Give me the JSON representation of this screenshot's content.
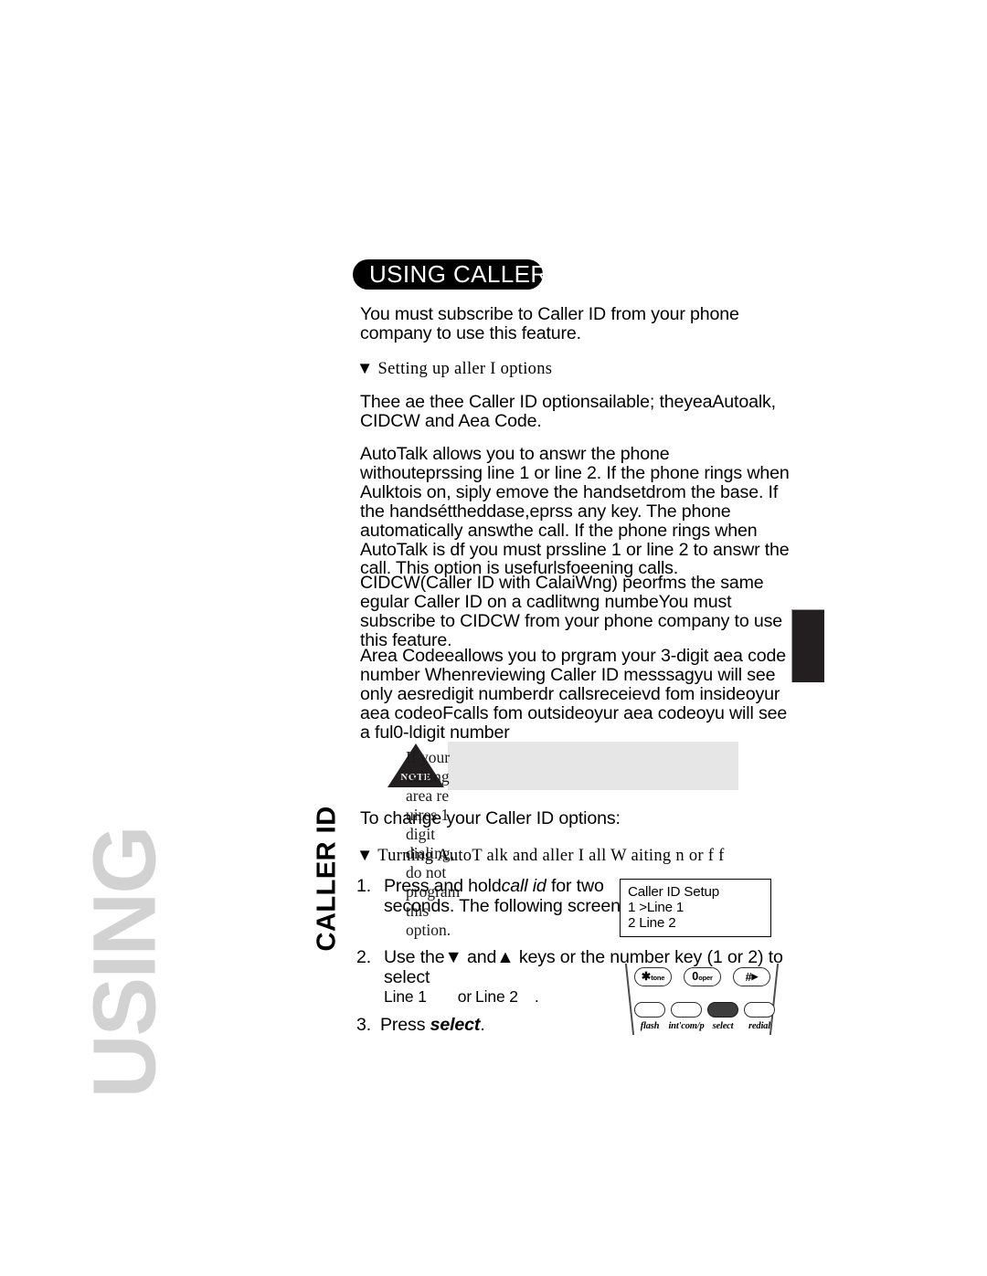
{
  "page": {
    "side_tab_ghost": "USING",
    "side_tab_label": "CALLER ID"
  },
  "header": {
    "banner_title": "USING CALLER ID"
  },
  "intro": {
    "text": "You must subscribe to Caller ID from your phone company to use this feature."
  },
  "subheads": {
    "setting_up": "▼ Setting up  aller I  options",
    "turning_on_off": "▼ Turning AutoT alk and   aller I    all W  aiting  n or   f f"
  },
  "paragraphs": {
    "options_intro": "Thee ae thee Caller ID optionsailable; theyeaAutoalk, CIDCW and Aea Code.",
    "autotalk": "AutoTalk allows you to answr the phone withouteprssing line 1 or line 2. If the phone rings when Aulktois on, siply emove the handsetdrom the base. If the handséttheddase,eprss any key. The phone automatically answthe call. If the phone rings when AutoTalk is df you must prssline 1 or line 2 to answr the call. This option is usefurlsfoeening calls.",
    "cidcw": "CIDCW(Caller ID with CalaiWng) peorfms the same egular Caller ID on a cadlitwng numbeYou must subscribe to CIDCW from your phone company to use this feature.",
    "area_code": "Area Codeeallows you to prgram your 3-digit aea code number Whenreviewing Caller ID messsagyu will see only aesredigit numberdr callsreceievd fom insideoyur aea codeoFcalls fom outsideoyur aea codeoyu will see a ful0-ldigit number"
  },
  "note": {
    "badge": "NOTE",
    "text": "If your calling area re uires 1      digit dialing,\ndo not program this option."
  },
  "to_change": {
    "text": "To change your Caller ID options:"
  },
  "steps": [
    {
      "number": "1.",
      "line1_a": "Press and hold",
      "line1_italic": "call id",
      "line1_b": " for two",
      "line2": "seconds. The following screen appears"
    },
    {
      "number": "2.",
      "line1_a": "Use  the",
      "line1_b": " and",
      "line1_c": " keys or the number key (1 or 2) to select",
      "line2_a": "Line 1",
      "line2_b": "or",
      "line2_c": "Line 2",
      "line2_d": "."
    },
    {
      "number": "3.",
      "text_a": "Press ",
      "text_italic": "select",
      "text_b": "."
    }
  ],
  "lcd": {
    "line1": "Caller ID Setup",
    "line2": "1 >Line 1",
    "line3": "2 Line 2"
  },
  "keypad": {
    "keys": [
      {
        "main": "*",
        "sub": "tone"
      },
      {
        "main": "0",
        "sub": "oper"
      },
      {
        "main": "#",
        "sub": "▶"
      }
    ],
    "soft_labels": [
      "flash",
      "int'com/p",
      "select",
      "redial"
    ],
    "selected_soft_index": 2
  },
  "colors": {
    "banner_bg": "#000000",
    "banner_text": "#ffffff",
    "note_bg": "#e6e6e6",
    "note_triangle": "#231f20",
    "side_ghost": "#d2d2d2",
    "edge_tab": "#231f20",
    "body_text": "#000000"
  }
}
